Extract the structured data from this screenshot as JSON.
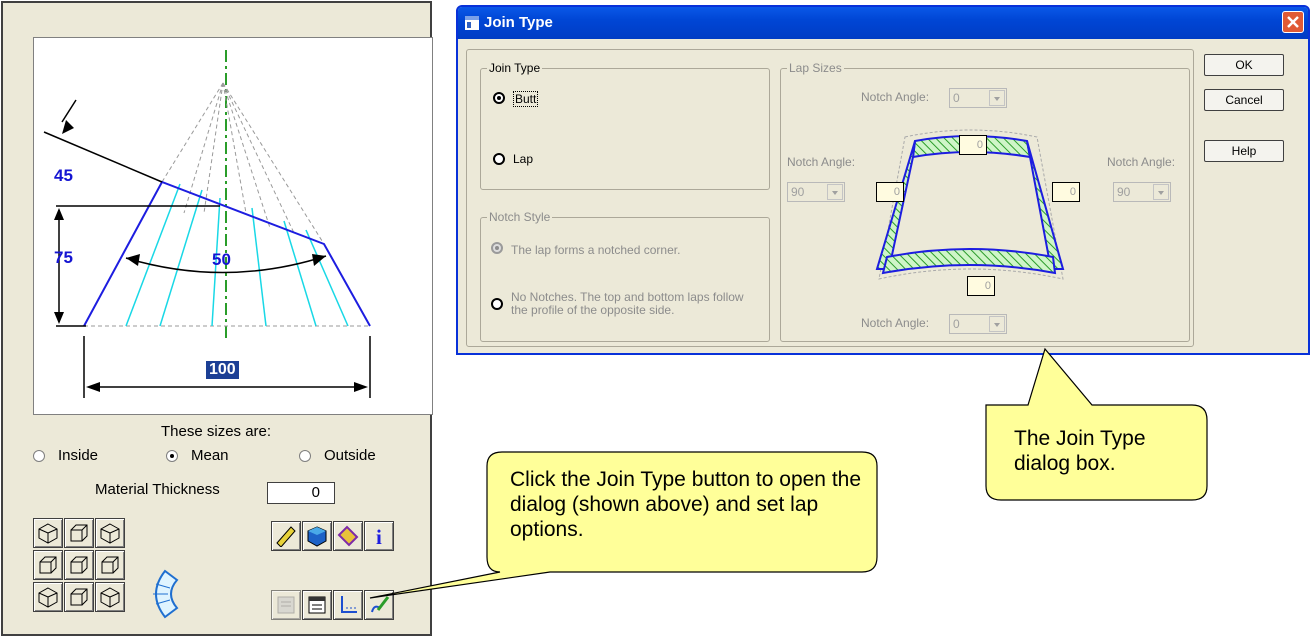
{
  "left_panel": {
    "dimensions": {
      "top_dim": "45",
      "left_dim": "75",
      "arc_dim": "50",
      "base_dim": "100"
    },
    "sizes_label": "These sizes are:",
    "radios": [
      {
        "label": "Inside",
        "checked": false
      },
      {
        "label": "Mean",
        "checked": true
      },
      {
        "label": "Outside",
        "checked": false
      }
    ],
    "thickness_label": "Material Thickness",
    "thickness_value": "0",
    "view_icons": [
      "iso-view-icon",
      "box-view-icon",
      "iso-view-icon",
      "box-view-icon",
      "box-view-icon",
      "box-view-icon",
      "iso-view-icon",
      "box-view-icon",
      "iso-view-icon"
    ],
    "tool_icons": [
      "ruler-icon",
      "cube-icon",
      "tag-icon",
      "info-icon"
    ],
    "bottom_icons": [
      "sheet-icon",
      "properties-icon",
      "join-type-icon",
      "edit-pen-icon"
    ]
  },
  "dialog": {
    "title": "Join Type",
    "join_type_group": "Join Type",
    "join_options": [
      {
        "label": "Butt",
        "checked": true
      },
      {
        "label": "Lap",
        "checked": false
      }
    ],
    "notch_style_group": "Notch Style",
    "notch_options": [
      {
        "label": "The lap forms a notched corner.",
        "checked": true
      },
      {
        "label": "No Notches. The top and bottom laps follow the profile of the opposite side.",
        "checked": false
      }
    ],
    "lap_sizes_group": "Lap Sizes",
    "notch_angle_label": "Notch Angle:",
    "top_notch": "0",
    "left_notch": "90",
    "right_notch": "90",
    "bottom_notch": "0",
    "lap_values": {
      "top": "0",
      "left": "0",
      "right": "0",
      "bottom": "0"
    },
    "buttons": {
      "ok": "OK",
      "cancel": "Cancel",
      "help": "Help"
    }
  },
  "callouts": {
    "join_button": "Click the Join Type button to open the dialog (shown above) and set lap options.",
    "dialog": "The Join Type dialog box."
  },
  "colors": {
    "callout_fill": "#ffff99",
    "titlebar": "#0046d5",
    "dimension_text": "#1414d2"
  }
}
